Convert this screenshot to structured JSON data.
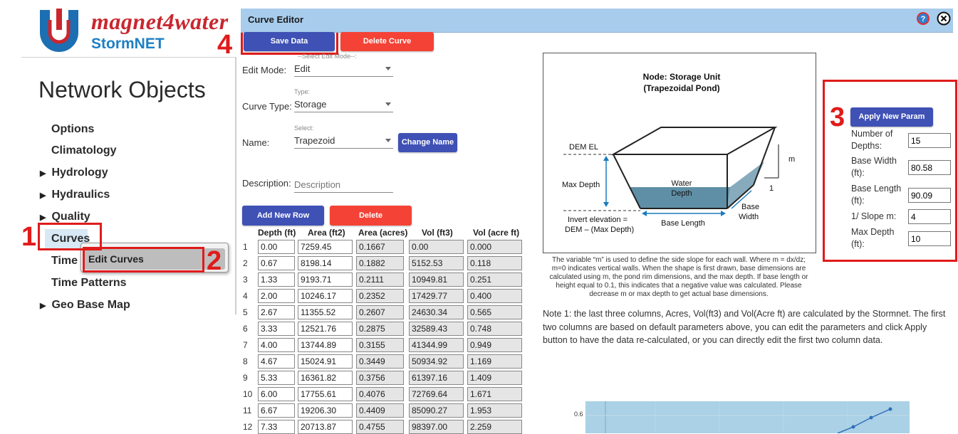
{
  "brand": {
    "name": "magnet4water",
    "product": "StormNET"
  },
  "sidebar": {
    "title": "Network Objects",
    "items": [
      {
        "label": "Options",
        "expandable": false
      },
      {
        "label": "Climatology",
        "expandable": false
      },
      {
        "label": "Hydrology",
        "expandable": true
      },
      {
        "label": "Hydraulics",
        "expandable": true
      },
      {
        "label": "Quality",
        "expandable": true
      },
      {
        "label": "Curves",
        "expandable": false
      },
      {
        "label": "Time",
        "expandable": false
      },
      {
        "label": "Time Patterns",
        "expandable": false
      },
      {
        "label": "Geo Base Map",
        "expandable": true
      }
    ],
    "popup_menu": {
      "label": "Edit Curves"
    }
  },
  "annotations": [
    "1",
    "2",
    "3",
    "4"
  ],
  "editor": {
    "title": "Curve Editor",
    "icons": {
      "help": "help-icon",
      "close": "close-icon"
    },
    "save_button": "Save Data",
    "delete_curve_button": "Delete Curve",
    "edit_mode": {
      "label": "Edit Mode:",
      "hint": "--Select Edit Mode--:",
      "value": "Edit"
    },
    "curve_type": {
      "label": "Curve Type:",
      "hint": "Type:",
      "value": "Storage"
    },
    "name": {
      "label": "Name:",
      "hint": "Select:",
      "value": "Trapezoid",
      "change_button": "Change Name"
    },
    "description": {
      "label": "Description:",
      "placeholder": "Description"
    },
    "add_row_button": "Add New Row",
    "delete_row_button": "Delete",
    "table": {
      "headers": [
        "Depth (ft)",
        "Area (ft2)",
        "Area (acres)",
        "Vol (ft3)",
        "Vol (acre ft)"
      ],
      "rows": [
        [
          "1",
          "0.00",
          "7259.45",
          "0.1667",
          "0.00",
          "0.000"
        ],
        [
          "2",
          "0.67",
          "8198.14",
          "0.1882",
          "5152.53",
          "0.118"
        ],
        [
          "3",
          "1.33",
          "9193.71",
          "0.2111",
          "10949.81",
          "0.251"
        ],
        [
          "4",
          "2.00",
          "10246.17",
          "0.2352",
          "17429.77",
          "0.400"
        ],
        [
          "5",
          "2.67",
          "11355.52",
          "0.2607",
          "24630.34",
          "0.565"
        ],
        [
          "6",
          "3.33",
          "12521.76",
          "0.2875",
          "32589.43",
          "0.748"
        ],
        [
          "7",
          "4.00",
          "13744.89",
          "0.3155",
          "41344.99",
          "0.949"
        ],
        [
          "8",
          "4.67",
          "15024.91",
          "0.3449",
          "50934.92",
          "1.169"
        ],
        [
          "9",
          "5.33",
          "16361.82",
          "0.3756",
          "61397.16",
          "1.409"
        ],
        [
          "10",
          "6.00",
          "17755.61",
          "0.4076",
          "72769.64",
          "1.671"
        ],
        [
          "11",
          "6.67",
          "19206.30",
          "0.4409",
          "85090.27",
          "1.953"
        ],
        [
          "12",
          "7.33",
          "20713.87",
          "0.4755",
          "98397.00",
          "2.259"
        ]
      ]
    },
    "diagram": {
      "title_line1": "Node: Storage Unit",
      "title_line2": "(Trapezoidal Pond)",
      "dem_el": "DEM EL",
      "max_depth": "Max Depth",
      "water_depth_1": "Water",
      "water_depth_2": "Depth",
      "m": "m",
      "one": "1",
      "base_width_1": "Base",
      "base_width_2": "Width",
      "base_length": "Base Length",
      "invert_1": "Invert elevation =",
      "invert_2": "DEM – (Max Depth)"
    },
    "caption": "The variable “m” is used to define the side slope for each wall.  Where m = dx/dz; m=0 indicates vertical walls. When the shape is first drawn, base dimensions are calculated using m, the pond rim dimensions, and the max depth. If base length or height equal to  0.1, this indicates that a negative value was calculated.  Please decrease m or max depth to get actual base dimensions.",
    "note": "Note 1: the last three columns, Acres, Vol(ft3) and Vol(Acre ft) are calculated by the Stormnet. The first two columns are based on default parameters above, you can edit the parameters and click Apply button to have the data re-calculated, or you can directly edit the first two column data.",
    "params": {
      "apply_button": "Apply New Param",
      "fields": [
        {
          "label": "Number of Depths:",
          "value": "15"
        },
        {
          "label": "Base Width (ft):",
          "value": "80.58"
        },
        {
          "label": "Base Length (ft):",
          "value": "90.09"
        },
        {
          "label": "1/ Slope m:",
          "value": "4"
        },
        {
          "label": "Max Depth (ft):",
          "value": "10"
        }
      ]
    },
    "chart": {
      "y_tick": "0.6"
    }
  }
}
